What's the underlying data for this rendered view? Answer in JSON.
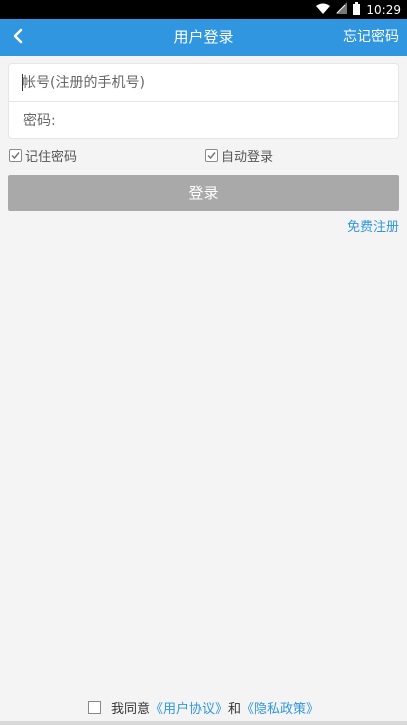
{
  "status_bar": {
    "time": "10:29"
  },
  "app_bar": {
    "title": "用户登录",
    "right_action": "忘记密码"
  },
  "form": {
    "account_placeholder": "帐号(注册的手机号)",
    "password_label": "密码:"
  },
  "options": {
    "remember_password": "记住密码",
    "auto_login": "自动登录",
    "remember_checked": true,
    "auto_checked": true
  },
  "buttons": {
    "login": "登录",
    "register": "免费注册"
  },
  "agreement": {
    "prefix": "我同意",
    "user_agreement": "《用户协议》",
    "conjunction": "和",
    "privacy_policy": "《隐私政策》",
    "checked": false
  },
  "colors": {
    "primary": "#3096e0",
    "button_disabled": "#a9a9a9",
    "background": "#f4f4f4"
  },
  "icons": {
    "back": "chevron-left-icon",
    "wifi": "wifi-icon",
    "signal": "signal-icon",
    "battery": "battery-icon"
  }
}
